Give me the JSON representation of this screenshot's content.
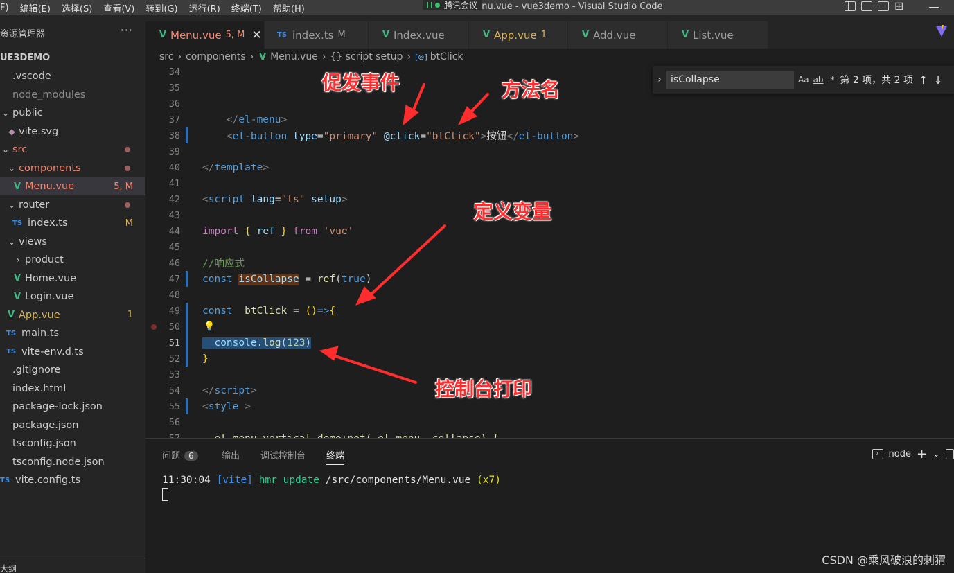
{
  "menubar": {
    "items": [
      "F)",
      "编辑(E)",
      "选择(S)",
      "查看(V)",
      "转到(G)",
      "运行(R)",
      "终端(T)",
      "帮助(H)"
    ],
    "overlay_app": "腾讯会议",
    "title": "Menu.vue - vue3demo - Visual Studio Code"
  },
  "sidebar": {
    "header": "资源管理器",
    "more": "···",
    "project": "UE3DEMO",
    "items": [
      {
        "label": ".vscode",
        "icon": "",
        "indent": 0,
        "color": "normal",
        "badge": ""
      },
      {
        "label": "node_modules",
        "icon": "",
        "indent": 0,
        "color": "grey",
        "badge": ""
      },
      {
        "label": "public",
        "icon": "chevron-down",
        "indent": 0,
        "color": "normal",
        "badge": ""
      },
      {
        "label": "vite.svg",
        "icon": "svg",
        "indent": 1,
        "color": "normal",
        "badge": ""
      },
      {
        "label": "src",
        "icon": "chevron-down",
        "indent": 0,
        "color": "red",
        "badge": "dot"
      },
      {
        "label": "components",
        "icon": "chevron-down",
        "indent": 1,
        "color": "red",
        "badge": "dot"
      },
      {
        "label": "Menu.vue",
        "icon": "vue",
        "indent": 2,
        "color": "red",
        "badge": "5, M"
      },
      {
        "label": "router",
        "icon": "chevron-down",
        "indent": 1,
        "color": "normal",
        "badge": "dot"
      },
      {
        "label": "index.ts",
        "icon": "ts",
        "indent": 2,
        "color": "normal",
        "badge": "M"
      },
      {
        "label": "views",
        "icon": "chevron-down",
        "indent": 1,
        "color": "normal",
        "badge": ""
      },
      {
        "label": "product",
        "icon": "chevron-right",
        "indent": 2,
        "color": "normal",
        "badge": ""
      },
      {
        "label": "Home.vue",
        "icon": "vue",
        "indent": 2,
        "color": "normal",
        "badge": ""
      },
      {
        "label": "Login.vue",
        "icon": "vue",
        "indent": 2,
        "color": "normal",
        "badge": ""
      },
      {
        "label": "App.vue",
        "icon": "vue",
        "indent": 1,
        "color": "yellow",
        "badge": "1"
      },
      {
        "label": "main.ts",
        "icon": "ts",
        "indent": 1,
        "color": "normal",
        "badge": ""
      },
      {
        "label": "vite-env.d.ts",
        "icon": "ts",
        "indent": 1,
        "color": "normal",
        "badge": ""
      },
      {
        "label": ".gitignore",
        "icon": "",
        "indent": 0,
        "color": "normal",
        "badge": ""
      },
      {
        "label": "index.html",
        "icon": "",
        "indent": 0,
        "color": "normal",
        "badge": ""
      },
      {
        "label": "package-lock.json",
        "icon": "",
        "indent": 0,
        "color": "normal",
        "badge": ""
      },
      {
        "label": "package.json",
        "icon": "",
        "indent": 0,
        "color": "normal",
        "badge": ""
      },
      {
        "label": "tsconfig.json",
        "icon": "",
        "indent": 0,
        "color": "normal",
        "badge": ""
      },
      {
        "label": "tsconfig.node.json",
        "icon": "",
        "indent": 0,
        "color": "normal",
        "badge": ""
      },
      {
        "label": "vite.config.ts",
        "icon": "ts",
        "indent": 0,
        "color": "normal",
        "badge": ""
      }
    ],
    "footer": "大纲"
  },
  "tabs": [
    {
      "label": "Menu.vue",
      "mod": "5, M",
      "icon": "vue",
      "active": true
    },
    {
      "label": "index.ts",
      "mod": "M",
      "icon": "ts",
      "active": false
    },
    {
      "label": "Index.vue",
      "mod": "",
      "icon": "vue",
      "active": false
    },
    {
      "label": "App.vue",
      "mod": "1",
      "icon": "vue",
      "active": false
    },
    {
      "label": "Add.vue",
      "mod": "",
      "icon": "vue",
      "active": false
    },
    {
      "label": "List.vue",
      "mod": "",
      "icon": "vue",
      "active": false
    }
  ],
  "breadcrumb": [
    "src",
    "components",
    "Menu.vue",
    "{} script setup",
    "btClick"
  ],
  "find": {
    "value": "isCollapse",
    "options": [
      "Aa",
      "ab",
      ".*"
    ],
    "count": "第 2 项，共 2 项"
  },
  "code": {
    "current_line": 51,
    "lines": [
      {
        "n": 34,
        "tokens": []
      },
      {
        "n": 35,
        "tokens": []
      },
      {
        "n": 36,
        "tokens": []
      },
      {
        "n": 37,
        "tokens": [
          [
            "    ",
            ""
          ],
          [
            "</",
            "tk-bracket"
          ],
          [
            "el-menu",
            "tk-tag"
          ],
          [
            ">",
            "tk-bracket"
          ]
        ]
      },
      {
        "n": 38,
        "tokens": [
          [
            "    ",
            ""
          ],
          [
            "<",
            "tk-bracket"
          ],
          [
            "el-button",
            "tk-tag"
          ],
          [
            " ",
            ""
          ],
          [
            "type",
            "tk-attr"
          ],
          [
            "=",
            ""
          ],
          [
            "\"primary\"",
            "tk-str"
          ],
          [
            " ",
            ""
          ],
          [
            "@click",
            "tk-attr"
          ],
          [
            "=",
            ""
          ],
          [
            "\"btClick\"",
            "tk-str"
          ],
          [
            ">",
            "tk-bracket"
          ],
          [
            "按钮",
            ""
          ],
          [
            "</",
            "tk-bracket"
          ],
          [
            "el-button",
            "tk-tag"
          ],
          [
            ">",
            "tk-bracket"
          ]
        ]
      },
      {
        "n": 39,
        "tokens": []
      },
      {
        "n": 40,
        "tokens": [
          [
            "</",
            "tk-bracket"
          ],
          [
            "template",
            "tk-tag"
          ],
          [
            ">",
            "tk-bracket"
          ]
        ]
      },
      {
        "n": 41,
        "tokens": []
      },
      {
        "n": 42,
        "tokens": [
          [
            "<",
            "tk-bracket"
          ],
          [
            "script",
            "tk-tag"
          ],
          [
            " ",
            ""
          ],
          [
            "lang",
            "tk-attr"
          ],
          [
            "=",
            ""
          ],
          [
            "\"ts\"",
            "tk-str"
          ],
          [
            " ",
            ""
          ],
          [
            "setup",
            "tk-attr"
          ],
          [
            ">",
            "tk-bracket"
          ]
        ]
      },
      {
        "n": 43,
        "tokens": []
      },
      {
        "n": 44,
        "tokens": [
          [
            "import",
            "tk-import"
          ],
          [
            " ",
            ""
          ],
          [
            "{",
            "tk-brace"
          ],
          [
            " ",
            ""
          ],
          [
            "ref",
            "tk-var"
          ],
          [
            " ",
            ""
          ],
          [
            "}",
            "tk-brace"
          ],
          [
            " ",
            ""
          ],
          [
            "from",
            "tk-import"
          ],
          [
            " ",
            ""
          ],
          [
            "'vue'",
            "tk-str"
          ]
        ]
      },
      {
        "n": 45,
        "tokens": []
      },
      {
        "n": 46,
        "tokens": [
          [
            "//响应式",
            "tk-com"
          ]
        ]
      },
      {
        "n": 47,
        "tokens": [
          [
            "const",
            "tk-kw"
          ],
          [
            " ",
            ""
          ],
          [
            "isCollapse",
            "tk-var hl-find"
          ],
          [
            " = ",
            ""
          ],
          [
            "ref",
            "tk-fn"
          ],
          [
            "(",
            ""
          ],
          [
            "true",
            "tk-kw"
          ],
          [
            ")",
            ""
          ]
        ]
      },
      {
        "n": 48,
        "tokens": []
      },
      {
        "n": 49,
        "tokens": [
          [
            "const",
            "tk-kw"
          ],
          [
            "  ",
            ""
          ],
          [
            "btClick",
            "tk-fn"
          ],
          [
            " = ",
            ""
          ],
          [
            "()",
            "tk-brace"
          ],
          [
            "=>",
            "tk-kw"
          ],
          [
            "{",
            "tk-brace"
          ]
        ]
      },
      {
        "n": 50,
        "tokens": []
      },
      {
        "n": 51,
        "tokens": [
          [
            "  ",
            "hl-sel"
          ],
          [
            "console",
            "tk-var hl-sel"
          ],
          [
            ".",
            "hl-sel"
          ],
          [
            "log",
            "tk-fn hl-sel"
          ],
          [
            "(",
            "hl-sel"
          ],
          [
            "123",
            "tk-num hl-sel"
          ],
          [
            ")",
            "hl-sel"
          ]
        ]
      },
      {
        "n": 52,
        "tokens": [
          [
            "}",
            "tk-brace"
          ]
        ]
      },
      {
        "n": 53,
        "tokens": []
      },
      {
        "n": 54,
        "tokens": [
          [
            "</",
            "tk-bracket"
          ],
          [
            "script",
            "tk-tag"
          ],
          [
            ">",
            "tk-bracket"
          ]
        ]
      },
      {
        "n": 55,
        "tokens": [
          [
            "<",
            "tk-bracket"
          ],
          [
            "style",
            "tk-tag"
          ],
          [
            " >",
            "tk-bracket"
          ]
        ]
      },
      {
        "n": 56,
        "tokens": []
      },
      {
        "n": 57,
        "tokens": [
          [
            " .el-menu-vertical-demo:not(.el-menu--collapse) {",
            "tk-fn"
          ]
        ]
      }
    ]
  },
  "annotations": {
    "trigger_event": "促发事件",
    "method_name": "方法名",
    "define_variable": "定义变量",
    "console_print": "控制台打印"
  },
  "panel": {
    "tabs": [
      "问题",
      "输出",
      "调试控制台",
      "终端"
    ],
    "problems_count": "6",
    "active_tab": "终端",
    "terminal_profile": "node",
    "terminal": {
      "time": "11:30:04",
      "tag": "[vite]",
      "msg": "hmr update",
      "path": "/src/components/Menu.vue",
      "times": "(x7)"
    }
  },
  "watermark": "CSDN @乘风破浪的刺猬",
  "colors": {
    "editor_bg": "#1e1e1e",
    "sidebar_bg": "#252526",
    "annotation": "#ff2d2d",
    "vue_green": "#41b883",
    "ts_blue": "#3b8eea"
  }
}
